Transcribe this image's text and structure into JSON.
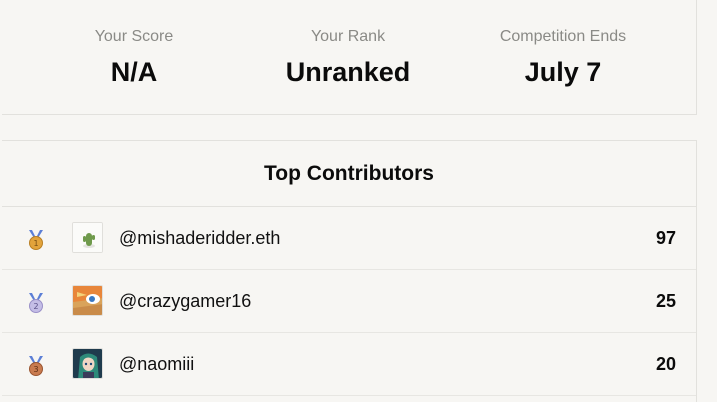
{
  "stats": {
    "score_label": "Your Score",
    "score_value": "N/A",
    "rank_label": "Your Rank",
    "rank_value": "Unranked",
    "ends_label": "Competition Ends",
    "ends_value": "July 7"
  },
  "contributors": {
    "title": "Top Contributors",
    "rows": [
      {
        "rank": "1",
        "handle": "@mishaderidder.eth",
        "score": "97",
        "medal_color": "#e2a33b",
        "avatar_icon": "cactus-avatar-icon"
      },
      {
        "rank": "2",
        "handle": "@crazygamer16",
        "score": "25",
        "medal_color": "#c4bde6",
        "avatar_icon": "cartoon-avatar-icon"
      },
      {
        "rank": "3",
        "handle": "@naomiii",
        "score": "20",
        "medal_color": "#c97b4f",
        "avatar_icon": "anime-avatar-icon"
      }
    ]
  },
  "colors": {
    "ribbon": "#5c7fd6",
    "background": "#f7f6f3",
    "divider": "#e2e1dd"
  }
}
